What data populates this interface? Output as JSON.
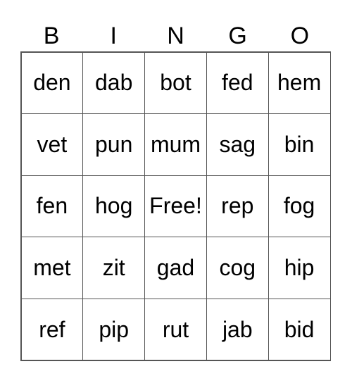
{
  "header": [
    "B",
    "I",
    "N",
    "G",
    "O"
  ],
  "cells": [
    [
      "den",
      "dab",
      "bot",
      "fed",
      "hem"
    ],
    [
      "vet",
      "pun",
      "mum",
      "sag",
      "bin"
    ],
    [
      "fen",
      "hog",
      "Free!",
      "rep",
      "fog"
    ],
    [
      "met",
      "zit",
      "gad",
      "cog",
      "hip"
    ],
    [
      "ref",
      "pip",
      "rut",
      "jab",
      "bid"
    ]
  ]
}
